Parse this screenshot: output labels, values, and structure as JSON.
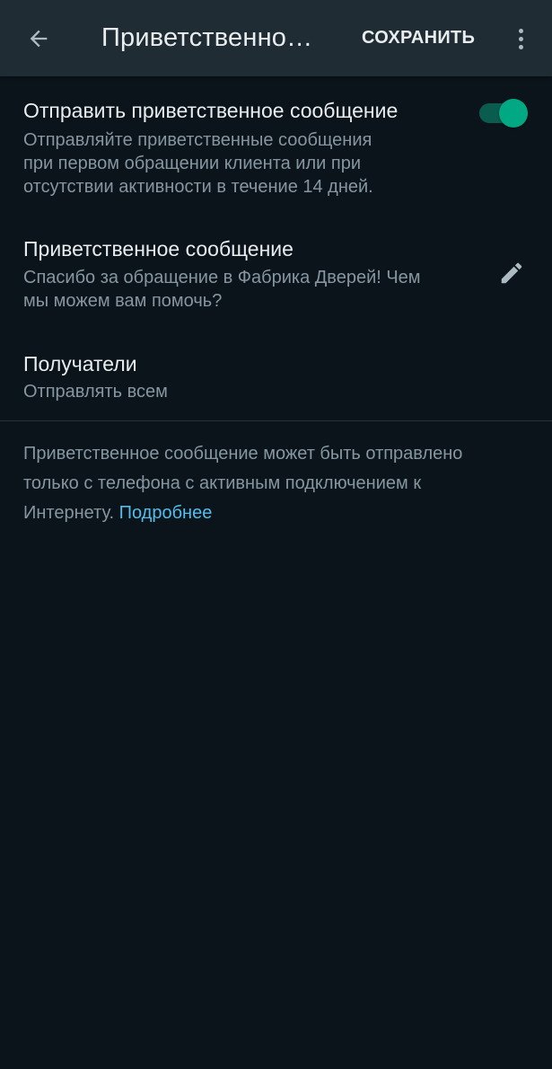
{
  "appbar": {
    "title": "Приветственно…",
    "save_label": "СОХРАНИТЬ",
    "icons": {
      "back": "arrow-left-icon",
      "more": "more-vert-icon"
    }
  },
  "greeting_toggle": {
    "title": "Отправить приветственное сообщение",
    "description": [
      "Отправляйте приветственные сообщения",
      "при первом обращении клиента или при",
      "отсутствии активности в течение 14 дней."
    ],
    "enabled": true
  },
  "greeting_message": {
    "title": "Приветственное сообщение",
    "text": [
      "Спасибо за обращение в Фабрика Дверей! Чем",
      "мы можем вам помочь?"
    ],
    "icon": "pencil-icon"
  },
  "recipients": {
    "title": "Получатели",
    "value": "Отправлять всем"
  },
  "footer": {
    "note_lines": [
      "Приветственное сообщение может быть отправлено",
      "только с телефона с активным подключением к",
      "Интернету. "
    ],
    "link_label": "Подробнее"
  },
  "colors": {
    "background": "#0b141b",
    "appbar": "#1f2c33",
    "accent": "#00a884",
    "link": "#53bdeb",
    "secondary_text": "#8696a0"
  }
}
